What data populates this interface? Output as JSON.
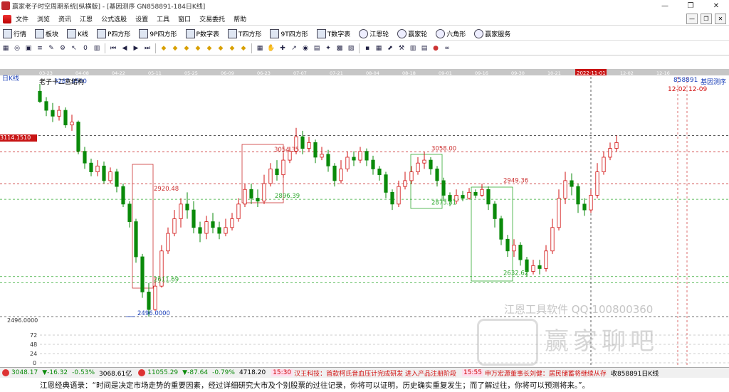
{
  "window": {
    "title": "赢家老子时空周期系统[纵横版] - [基因测序   GN858891-184日K线]",
    "buttons": [
      "—",
      "❐",
      "✕"
    ]
  },
  "menubar": {
    "items": [
      "文件",
      "浏览",
      "资讯",
      "江恩",
      "公式选股",
      "设置",
      "工具",
      "窗口",
      "交易委托",
      "帮助"
    ],
    "right_buttons": [
      "—",
      "❐",
      "✕"
    ]
  },
  "toolbar1": {
    "items": [
      "行情",
      "板块",
      "K线",
      "P四方形",
      "9P四方形",
      "P数字表",
      "T四方形",
      "9T四方形",
      "T数字表",
      "江恩轮",
      "赢家轮",
      "六角形",
      "赢家服务"
    ]
  },
  "toolbar2": {
    "icons": [
      "grid-icon",
      "octagon-icon",
      "square-icon",
      "bars-icon",
      "pen-icon",
      "settings-icon",
      "pointer-icon",
      "zero-icon",
      "chart-icon",
      "nav-first-icon",
      "nav-prev-icon",
      "nav-next-icon",
      "nav-last-icon",
      "diamond-icon",
      "diamond-icon",
      "diamond-icon",
      "diamond-icon",
      "diamond-icon",
      "diamond-icon",
      "diamond-icon",
      "diamond-icon",
      "grid-small-icon",
      "hand-icon",
      "cross-icon",
      "arrow-icon",
      "wheel-icon",
      "ticket-icon",
      "star-icon",
      "cube-icon",
      "report-icon",
      "disk-icon",
      "table-icon",
      "cursor-icon",
      "tool-icon",
      "bars2-icon",
      "bars3-icon",
      "ball-icon",
      "link-icon"
    ]
  },
  "chart": {
    "period_label": "日K线",
    "title": "老子十二宫结构",
    "code": "858891",
    "name": "基因测序",
    "range": "12-02 12-09",
    "current_price": "3114.1510",
    "current_date": "2022-11-01",
    "date_ticks": [
      "03-23",
      "04-08",
      "04-22",
      "05-11",
      "05-25",
      "06-09",
      "06-23",
      "07-07",
      "07-21",
      "08-04",
      "08-18",
      "09-01",
      "09-16",
      "09-30",
      "10-21",
      "11-18",
      "12-02",
      "12-16"
    ],
    "y_labels": [
      "2496.0000",
      "72",
      "48",
      "24",
      "0"
    ]
  },
  "chart_data": {
    "type": "candlestick",
    "title": "老子十二宫结构",
    "annotations": [
      {
        "text": "3287.9500",
        "value": 3287.95
      },
      {
        "text": "2920.48",
        "value": 2920.48
      },
      {
        "text": "2611.69",
        "value": 2611.69
      },
      {
        "text": "2896.39",
        "value": 2896.39
      },
      {
        "text": "3054.35",
        "value": 3054.35
      },
      {
        "text": "3058.00",
        "value": 3058.0
      },
      {
        "text": "2873.81",
        "value": 2873.81
      },
      {
        "text": "2949.36",
        "value": 2949.36
      },
      {
        "text": "2632.62",
        "value": 2632.62
      },
      {
        "text": "2496.0000",
        "value": 2496.0
      }
    ],
    "candles": [
      {
        "o": 3265,
        "c": 3230,
        "h": 3290,
        "l": 3225
      },
      {
        "o": 3230,
        "c": 3200,
        "h": 3245,
        "l": 3180
      },
      {
        "o": 3200,
        "c": 3180,
        "h": 3225,
        "l": 3160
      },
      {
        "o": 3180,
        "c": 3200,
        "h": 3215,
        "l": 3165
      },
      {
        "o": 3200,
        "c": 3150,
        "h": 3210,
        "l": 3140
      },
      {
        "o": 3150,
        "c": 3160,
        "h": 3185,
        "l": 3130
      },
      {
        "o": 3160,
        "c": 3060,
        "h": 3165,
        "l": 3050
      },
      {
        "o": 3060,
        "c": 3020,
        "h": 3075,
        "l": 3000
      },
      {
        "o": 3020,
        "c": 2990,
        "h": 3035,
        "l": 2975
      },
      {
        "o": 2990,
        "c": 3010,
        "h": 3030,
        "l": 2975
      },
      {
        "o": 3010,
        "c": 2960,
        "h": 3025,
        "l": 2950
      },
      {
        "o": 2960,
        "c": 2990,
        "h": 3005,
        "l": 2950
      },
      {
        "o": 2990,
        "c": 2940,
        "h": 3000,
        "l": 2920
      },
      {
        "o": 2940,
        "c": 2880,
        "h": 2950,
        "l": 2870
      },
      {
        "o": 2880,
        "c": 2820,
        "h": 2890,
        "l": 2800
      },
      {
        "o": 2820,
        "c": 2700,
        "h": 2830,
        "l": 2680
      },
      {
        "o": 2700,
        "c": 2580,
        "h": 2710,
        "l": 2560
      },
      {
        "o": 2580,
        "c": 2520,
        "h": 2610,
        "l": 2496
      },
      {
        "o": 2520,
        "c": 2600,
        "h": 2630,
        "l": 2515
      },
      {
        "o": 2600,
        "c": 2720,
        "h": 2740,
        "l": 2595
      },
      {
        "o": 2720,
        "c": 2780,
        "h": 2800,
        "l": 2710
      },
      {
        "o": 2780,
        "c": 2830,
        "h": 2860,
        "l": 2770
      },
      {
        "o": 2830,
        "c": 2880,
        "h": 2900,
        "l": 2800
      },
      {
        "o": 2880,
        "c": 2860,
        "h": 2920,
        "l": 2830
      },
      {
        "o": 2860,
        "c": 2800,
        "h": 2890,
        "l": 2780
      },
      {
        "o": 2800,
        "c": 2780,
        "h": 2820,
        "l": 2750
      },
      {
        "o": 2780,
        "c": 2820,
        "h": 2840,
        "l": 2760
      },
      {
        "o": 2820,
        "c": 2800,
        "h": 2850,
        "l": 2780
      },
      {
        "o": 2800,
        "c": 2780,
        "h": 2820,
        "l": 2760
      },
      {
        "o": 2780,
        "c": 2800,
        "h": 2830,
        "l": 2770
      },
      {
        "o": 2800,
        "c": 2830,
        "h": 2850,
        "l": 2790
      },
      {
        "o": 2830,
        "c": 2880,
        "h": 2900,
        "l": 2820
      },
      {
        "o": 2880,
        "c": 2930,
        "h": 2950,
        "l": 2870
      },
      {
        "o": 2930,
        "c": 2900,
        "h": 2950,
        "l": 2880
      },
      {
        "o": 2900,
        "c": 2890,
        "h": 2930,
        "l": 2870
      },
      {
        "o": 2890,
        "c": 2950,
        "h": 2980,
        "l": 2880
      },
      {
        "o": 2950,
        "c": 3000,
        "h": 3020,
        "l": 2940
      },
      {
        "o": 3000,
        "c": 2980,
        "h": 3030,
        "l": 2960
      },
      {
        "o": 2980,
        "c": 3030,
        "h": 3054,
        "l": 2970
      },
      {
        "o": 3030,
        "c": 3060,
        "h": 3075,
        "l": 3020
      },
      {
        "o": 3060,
        "c": 3110,
        "h": 3140,
        "l": 3050
      },
      {
        "o": 3110,
        "c": 3070,
        "h": 3130,
        "l": 3050
      },
      {
        "o": 3070,
        "c": 3090,
        "h": 3110,
        "l": 3060
      },
      {
        "o": 3090,
        "c": 3040,
        "h": 3100,
        "l": 3020
      },
      {
        "o": 3040,
        "c": 3050,
        "h": 3075,
        "l": 3030
      },
      {
        "o": 3050,
        "c": 3010,
        "h": 3065,
        "l": 2990
      },
      {
        "o": 3010,
        "c": 2960,
        "h": 3020,
        "l": 2940
      },
      {
        "o": 2960,
        "c": 3000,
        "h": 3030,
        "l": 2950
      },
      {
        "o": 3000,
        "c": 3040,
        "h": 3060,
        "l": 2990
      },
      {
        "o": 3040,
        "c": 3030,
        "h": 3060,
        "l": 3010
      },
      {
        "o": 3030,
        "c": 3060,
        "h": 3075,
        "l": 3020
      },
      {
        "o": 3060,
        "c": 3030,
        "h": 3070,
        "l": 3010
      },
      {
        "o": 3030,
        "c": 3000,
        "h": 3045,
        "l": 2980
      },
      {
        "o": 3000,
        "c": 2980,
        "h": 3010,
        "l": 2960
      },
      {
        "o": 2980,
        "c": 2920,
        "h": 2990,
        "l": 2900
      },
      {
        "o": 2920,
        "c": 2880,
        "h": 2930,
        "l": 2860
      },
      {
        "o": 2880,
        "c": 2940,
        "h": 2960,
        "l": 2870
      },
      {
        "o": 2940,
        "c": 2960,
        "h": 2990,
        "l": 2930
      },
      {
        "o": 2960,
        "c": 2990,
        "h": 3010,
        "l": 2950
      },
      {
        "o": 2990,
        "c": 3020,
        "h": 3040,
        "l": 2980
      },
      {
        "o": 3020,
        "c": 3030,
        "h": 3058,
        "l": 3000
      },
      {
        "o": 3030,
        "c": 3000,
        "h": 3040,
        "l": 2980
      },
      {
        "o": 3000,
        "c": 2960,
        "h": 3010,
        "l": 2940
      },
      {
        "o": 2960,
        "c": 2910,
        "h": 2970,
        "l": 2890
      },
      {
        "o": 2910,
        "c": 2890,
        "h": 2920,
        "l": 2873
      },
      {
        "o": 2890,
        "c": 2910,
        "h": 2930,
        "l": 2880
      },
      {
        "o": 2910,
        "c": 2900,
        "h": 2925,
        "l": 2890
      },
      {
        "o": 2900,
        "c": 2920,
        "h": 2935,
        "l": 2895
      },
      {
        "o": 2920,
        "c": 2910,
        "h": 2930,
        "l": 2900
      },
      {
        "o": 2910,
        "c": 2930,
        "h": 2949,
        "l": 2905
      },
      {
        "o": 2930,
        "c": 2880,
        "h": 2940,
        "l": 2860
      },
      {
        "o": 2880,
        "c": 2830,
        "h": 2890,
        "l": 2800
      },
      {
        "o": 2830,
        "c": 2760,
        "h": 2840,
        "l": 2740
      },
      {
        "o": 2760,
        "c": 2720,
        "h": 2775,
        "l": 2700
      },
      {
        "o": 2720,
        "c": 2740,
        "h": 2760,
        "l": 2700
      },
      {
        "o": 2740,
        "c": 2690,
        "h": 2750,
        "l": 2670
      },
      {
        "o": 2690,
        "c": 2650,
        "h": 2700,
        "l": 2632
      },
      {
        "o": 2650,
        "c": 2670,
        "h": 2690,
        "l": 2640
      },
      {
        "o": 2670,
        "c": 2660,
        "h": 2690,
        "l": 2640
      },
      {
        "o": 2660,
        "c": 2720,
        "h": 2740,
        "l": 2650
      },
      {
        "o": 2720,
        "c": 2800,
        "h": 2830,
        "l": 2710
      },
      {
        "o": 2800,
        "c": 2900,
        "h": 2930,
        "l": 2790
      },
      {
        "o": 2900,
        "c": 2960,
        "h": 2990,
        "l": 2880
      },
      {
        "o": 2960,
        "c": 2940,
        "h": 2985,
        "l": 2910
      },
      {
        "o": 2940,
        "c": 2880,
        "h": 2950,
        "l": 2850
      },
      {
        "o": 2880,
        "c": 2860,
        "h": 2900,
        "l": 2840
      },
      {
        "o": 2860,
        "c": 2910,
        "h": 2930,
        "l": 2850
      },
      {
        "o": 2910,
        "c": 2990,
        "h": 3020,
        "l": 2900
      },
      {
        "o": 2990,
        "c": 3040,
        "h": 3060,
        "l": 2980
      },
      {
        "o": 3040,
        "c": 3070,
        "h": 3090,
        "l": 3030
      },
      {
        "o": 3070,
        "c": 3090,
        "h": 3114,
        "l": 3060
      }
    ],
    "current_price": 3114.151
  },
  "statusbar": {
    "sh_index": "3048.17",
    "sh_change": "▼-16.32",
    "sh_pct": "-0.53%",
    "sh_extra": "3068.61亿",
    "sz_index": "11055.29",
    "sz_change": "▼-87.64",
    "sz_pct": "-0.79%",
    "sz_extra": "4718.20",
    "time1": "15:30",
    "news1": "汉王科技：首款柯氏音血压计完成研发 进入产品注册阶段",
    "time2": "15:55",
    "news2": "申万宏源董事长刘健：居民储蓄将继续从存",
    "tail": "收858891日K线"
  },
  "quote": {
    "text": "江恩经典语录：“时间是决定市场走势的重要因素，经过详细研究大市及个别股票的过往记录，你将可以证明，历史确实重复发生；而了解过往，你将可以预测将来。”。"
  },
  "watermark": {
    "line1": "江恩工具软件  QQ:100800360",
    "line2": "赢家聊吧"
  },
  "colors": {
    "up": "#d21010",
    "down": "#0a8a0a",
    "accent_blue": "#1a3fb8",
    "datebar": "#c6c6c6"
  }
}
